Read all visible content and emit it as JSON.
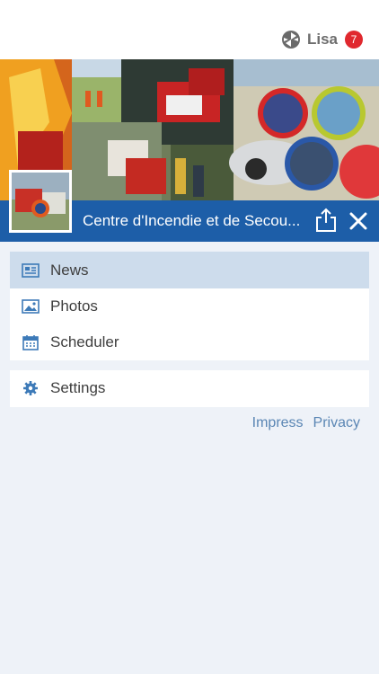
{
  "header": {
    "user_name": "Lisa",
    "notification_count": "7",
    "logo_icon": "hexagon-logo-icon"
  },
  "organization": {
    "title": "Centre d'Incendie et de Secou..."
  },
  "menu": {
    "items": [
      {
        "label": "News",
        "icon": "newspaper-icon",
        "active": true
      },
      {
        "label": "Photos",
        "icon": "image-icon",
        "active": false
      },
      {
        "label": "Scheduler",
        "icon": "calendar-icon",
        "active": false
      }
    ],
    "settings": {
      "label": "Settings",
      "icon": "gear-icon"
    }
  },
  "footer": {
    "impress": "Impress",
    "privacy": "Privacy"
  },
  "colors": {
    "brand_blue": "#1d5ea8",
    "active_row": "#cddcec",
    "badge_red": "#e0282e",
    "link_blue": "#5a86b4",
    "background": "#eef2f8"
  }
}
